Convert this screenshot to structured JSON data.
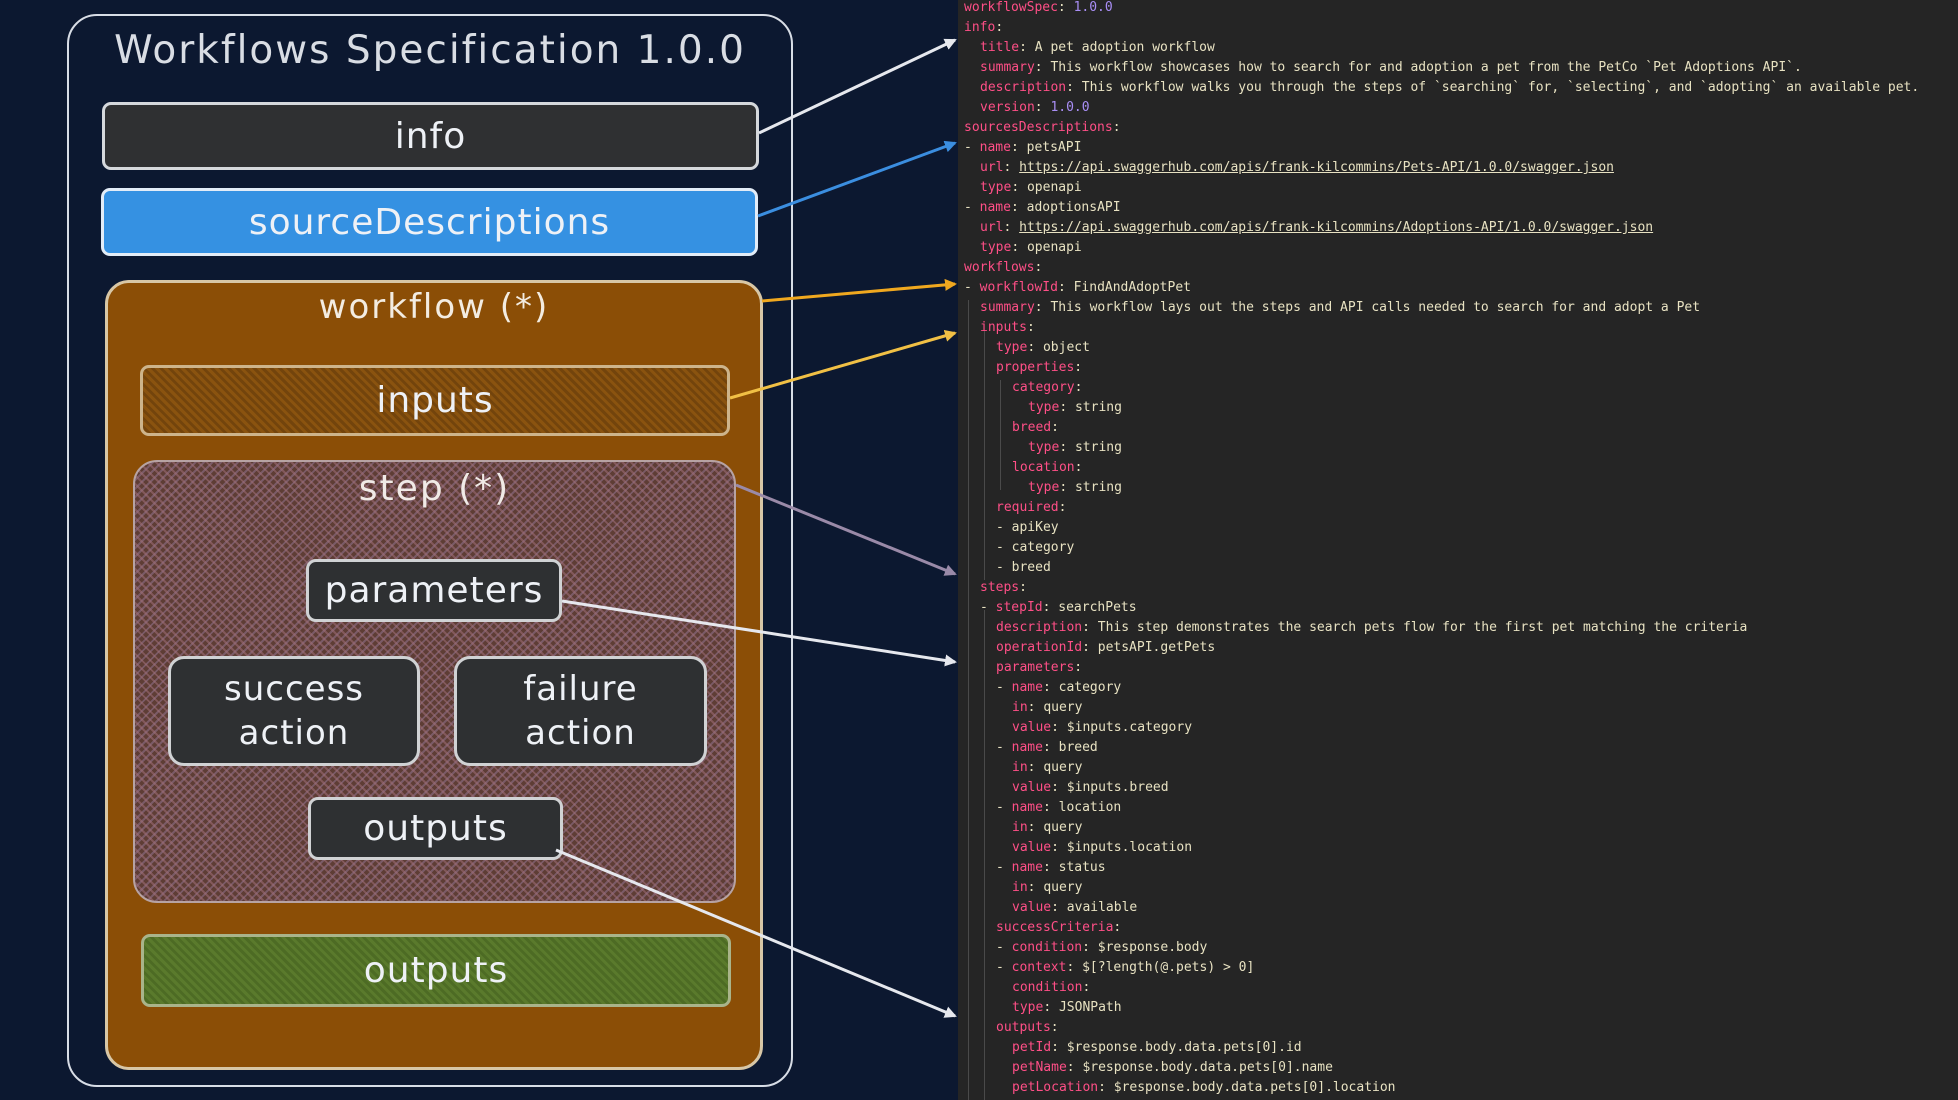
{
  "diagram": {
    "title": "Workflows Specification 1.0.0",
    "info": "info",
    "source_descriptions": "sourceDescriptions",
    "workflow": "workflow (*)",
    "inputs": "inputs",
    "step": "step (*)",
    "parameters": "parameters",
    "success_action": [
      "success",
      "action"
    ],
    "failure_action": [
      "failure",
      "action"
    ],
    "step_outputs": "outputs",
    "workflow_outputs": "outputs"
  },
  "colors": {
    "background": "#0c1830",
    "info": "#2f3032",
    "source_descriptions": "#3591e2",
    "workflow": "#8b4e06",
    "workflow_outputs": "#5a7a2c",
    "code_background": "#252525",
    "code_key": "#ff4f87",
    "code_number": "#a98ef5",
    "arrow_white": "#e6e8ee",
    "arrow_blue": "#3b8ee0",
    "arrow_orange": "#f0a81f",
    "arrow_yellow": "#f1c045",
    "arrow_purple": "#9a8aa8"
  },
  "code_lines": [
    {
      "indent": 0,
      "dash": false,
      "key": "workflowSpec",
      "value": "1.0.0",
      "type": "num"
    },
    {
      "indent": 0,
      "dash": false,
      "key": "info",
      "value": "",
      "type": "text"
    },
    {
      "indent": 1,
      "dash": false,
      "key": "title",
      "value": "A pet adoption workflow",
      "type": "text"
    },
    {
      "indent": 1,
      "dash": false,
      "key": "summary",
      "value": "This workflow showcases how to search for and adoption a pet from the PetCo `Pet Adoptions API`.",
      "type": "text"
    },
    {
      "indent": 1,
      "dash": false,
      "key": "description",
      "value": "This workflow walks you through the steps of `searching` for, `selecting`, and `adopting` an available pet.",
      "type": "text"
    },
    {
      "indent": 1,
      "dash": false,
      "key": "version",
      "value": "1.0.0",
      "type": "num"
    },
    {
      "indent": 0,
      "dash": false,
      "key": "sourcesDescriptions",
      "value": "",
      "type": "text"
    },
    {
      "indent": 0,
      "dash": true,
      "key": "name",
      "value": "petsAPI",
      "type": "text"
    },
    {
      "indent": 1,
      "dash": false,
      "key": "url",
      "value": "https://api.swaggerhub.com/apis/frank-kilcommins/Pets-API/1.0.0/swagger.json",
      "type": "url"
    },
    {
      "indent": 1,
      "dash": false,
      "key": "type",
      "value": "openapi",
      "type": "text"
    },
    {
      "indent": 0,
      "dash": true,
      "key": "name",
      "value": "adoptionsAPI",
      "type": "text"
    },
    {
      "indent": 1,
      "dash": false,
      "key": "url",
      "value": "https://api.swaggerhub.com/apis/frank-kilcommins/Adoptions-API/1.0.0/swagger.json",
      "type": "url"
    },
    {
      "indent": 1,
      "dash": false,
      "key": "type",
      "value": "openapi",
      "type": "text"
    },
    {
      "indent": 0,
      "dash": false,
      "key": "workflows",
      "value": "",
      "type": "text"
    },
    {
      "indent": 0,
      "dash": true,
      "key": "workflowId",
      "value": "FindAndAdoptPet",
      "type": "text"
    },
    {
      "indent": 1,
      "dash": false,
      "key": "summary",
      "value": "This workflow lays out the steps and API calls needed to search for and adopt a Pet",
      "type": "text"
    },
    {
      "indent": 1,
      "dash": false,
      "key": "inputs",
      "value": "",
      "type": "text"
    },
    {
      "indent": 2,
      "dash": false,
      "key": "type",
      "value": "object",
      "type": "text"
    },
    {
      "indent": 2,
      "dash": false,
      "key": "properties",
      "value": "",
      "type": "text"
    },
    {
      "indent": 3,
      "dash": false,
      "key": "category",
      "value": "",
      "type": "text"
    },
    {
      "indent": 4,
      "dash": false,
      "key": "type",
      "value": "string",
      "type": "text"
    },
    {
      "indent": 3,
      "dash": false,
      "key": "breed",
      "value": "",
      "type": "text"
    },
    {
      "indent": 4,
      "dash": false,
      "key": "type",
      "value": "string",
      "type": "text"
    },
    {
      "indent": 3,
      "dash": false,
      "key": "location",
      "value": "",
      "type": "text"
    },
    {
      "indent": 4,
      "dash": false,
      "key": "type",
      "value": "string",
      "type": "text"
    },
    {
      "indent": 2,
      "dash": false,
      "key": "required",
      "value": "",
      "type": "text"
    },
    {
      "indent": 2,
      "dash": true,
      "key": "",
      "value": "apiKey",
      "type": "text"
    },
    {
      "indent": 2,
      "dash": true,
      "key": "",
      "value": "category",
      "type": "text"
    },
    {
      "indent": 2,
      "dash": true,
      "key": "",
      "value": "breed",
      "type": "text"
    },
    {
      "indent": 1,
      "dash": false,
      "key": "steps",
      "value": "",
      "type": "text"
    },
    {
      "indent": 1,
      "dash": true,
      "key": "stepId",
      "value": "searchPets",
      "type": "text"
    },
    {
      "indent": 2,
      "dash": false,
      "key": "description",
      "value": "This step demonstrates the search pets flow for the first pet matching the criteria",
      "type": "text"
    },
    {
      "indent": 2,
      "dash": false,
      "key": "operationId",
      "value": "petsAPI.getPets",
      "type": "text"
    },
    {
      "indent": 2,
      "dash": false,
      "key": "parameters",
      "value": "",
      "type": "text"
    },
    {
      "indent": 2,
      "dash": true,
      "key": "name",
      "value": "category",
      "type": "text"
    },
    {
      "indent": 3,
      "dash": false,
      "key": "in",
      "value": "query",
      "type": "text"
    },
    {
      "indent": 3,
      "dash": false,
      "key": "value",
      "value": "$inputs.category",
      "type": "text"
    },
    {
      "indent": 2,
      "dash": true,
      "key": "name",
      "value": "breed",
      "type": "text"
    },
    {
      "indent": 3,
      "dash": false,
      "key": "in",
      "value": "query",
      "type": "text"
    },
    {
      "indent": 3,
      "dash": false,
      "key": "value",
      "value": "$inputs.breed",
      "type": "text"
    },
    {
      "indent": 2,
      "dash": true,
      "key": "name",
      "value": "location",
      "type": "text"
    },
    {
      "indent": 3,
      "dash": false,
      "key": "in",
      "value": "query",
      "type": "text"
    },
    {
      "indent": 3,
      "dash": false,
      "key": "value",
      "value": "$inputs.location",
      "type": "text"
    },
    {
      "indent": 2,
      "dash": true,
      "key": "name",
      "value": "status",
      "type": "text"
    },
    {
      "indent": 3,
      "dash": false,
      "key": "in",
      "value": "query",
      "type": "text"
    },
    {
      "indent": 3,
      "dash": false,
      "key": "value",
      "value": "available",
      "type": "text"
    },
    {
      "indent": 2,
      "dash": false,
      "key": "successCriteria",
      "value": "",
      "type": "text"
    },
    {
      "indent": 2,
      "dash": true,
      "key": "condition",
      "value": "$response.body",
      "type": "text"
    },
    {
      "indent": 2,
      "dash": true,
      "key": "context",
      "value": "$[?length(@.pets) > 0]",
      "type": "text"
    },
    {
      "indent": 3,
      "dash": false,
      "key": "condition",
      "value": "",
      "type": "text"
    },
    {
      "indent": 3,
      "dash": false,
      "key": "type",
      "value": "JSONPath",
      "type": "text"
    },
    {
      "indent": 2,
      "dash": false,
      "key": "outputs",
      "value": "",
      "type": "text"
    },
    {
      "indent": 3,
      "dash": false,
      "key": "petId",
      "value": "$response.body.data.pets[0].id",
      "type": "text"
    },
    {
      "indent": 3,
      "dash": false,
      "key": "petName",
      "value": "$response.body.data.pets[0].name",
      "type": "text"
    },
    {
      "indent": 3,
      "dash": false,
      "key": "petLocation",
      "value": "$response.body.data.pets[0].location",
      "type": "text"
    }
  ]
}
